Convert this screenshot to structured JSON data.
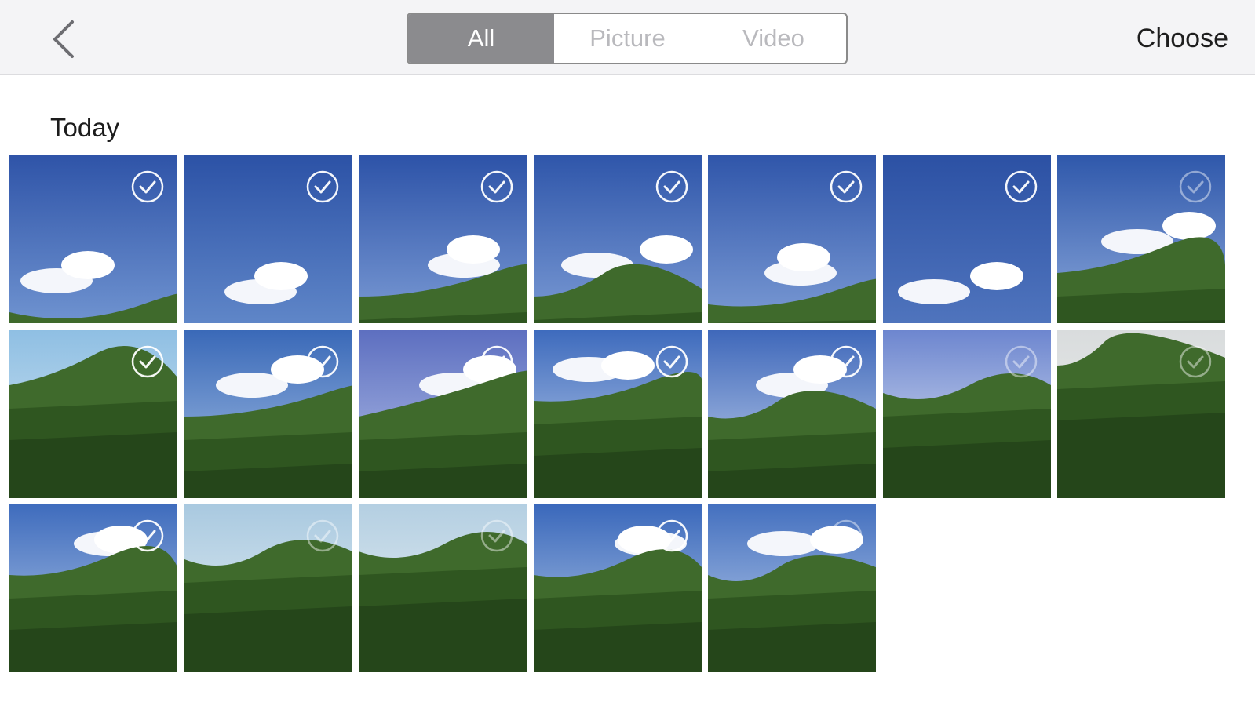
{
  "header": {
    "back_icon": "chevron-left-icon",
    "tabs": [
      {
        "label": "All",
        "active": true
      },
      {
        "label": "Picture",
        "active": false
      },
      {
        "label": "Video",
        "active": false
      }
    ],
    "choose_label": "Choose"
  },
  "gallery": {
    "section_title": "Today",
    "photo_count": 19,
    "selection_icon": "check-circle-icon",
    "accent_colors": {
      "sky": "#3f64b4",
      "selected_tab": "#8b8b8e",
      "header_bg": "#f4f4f6"
    }
  }
}
